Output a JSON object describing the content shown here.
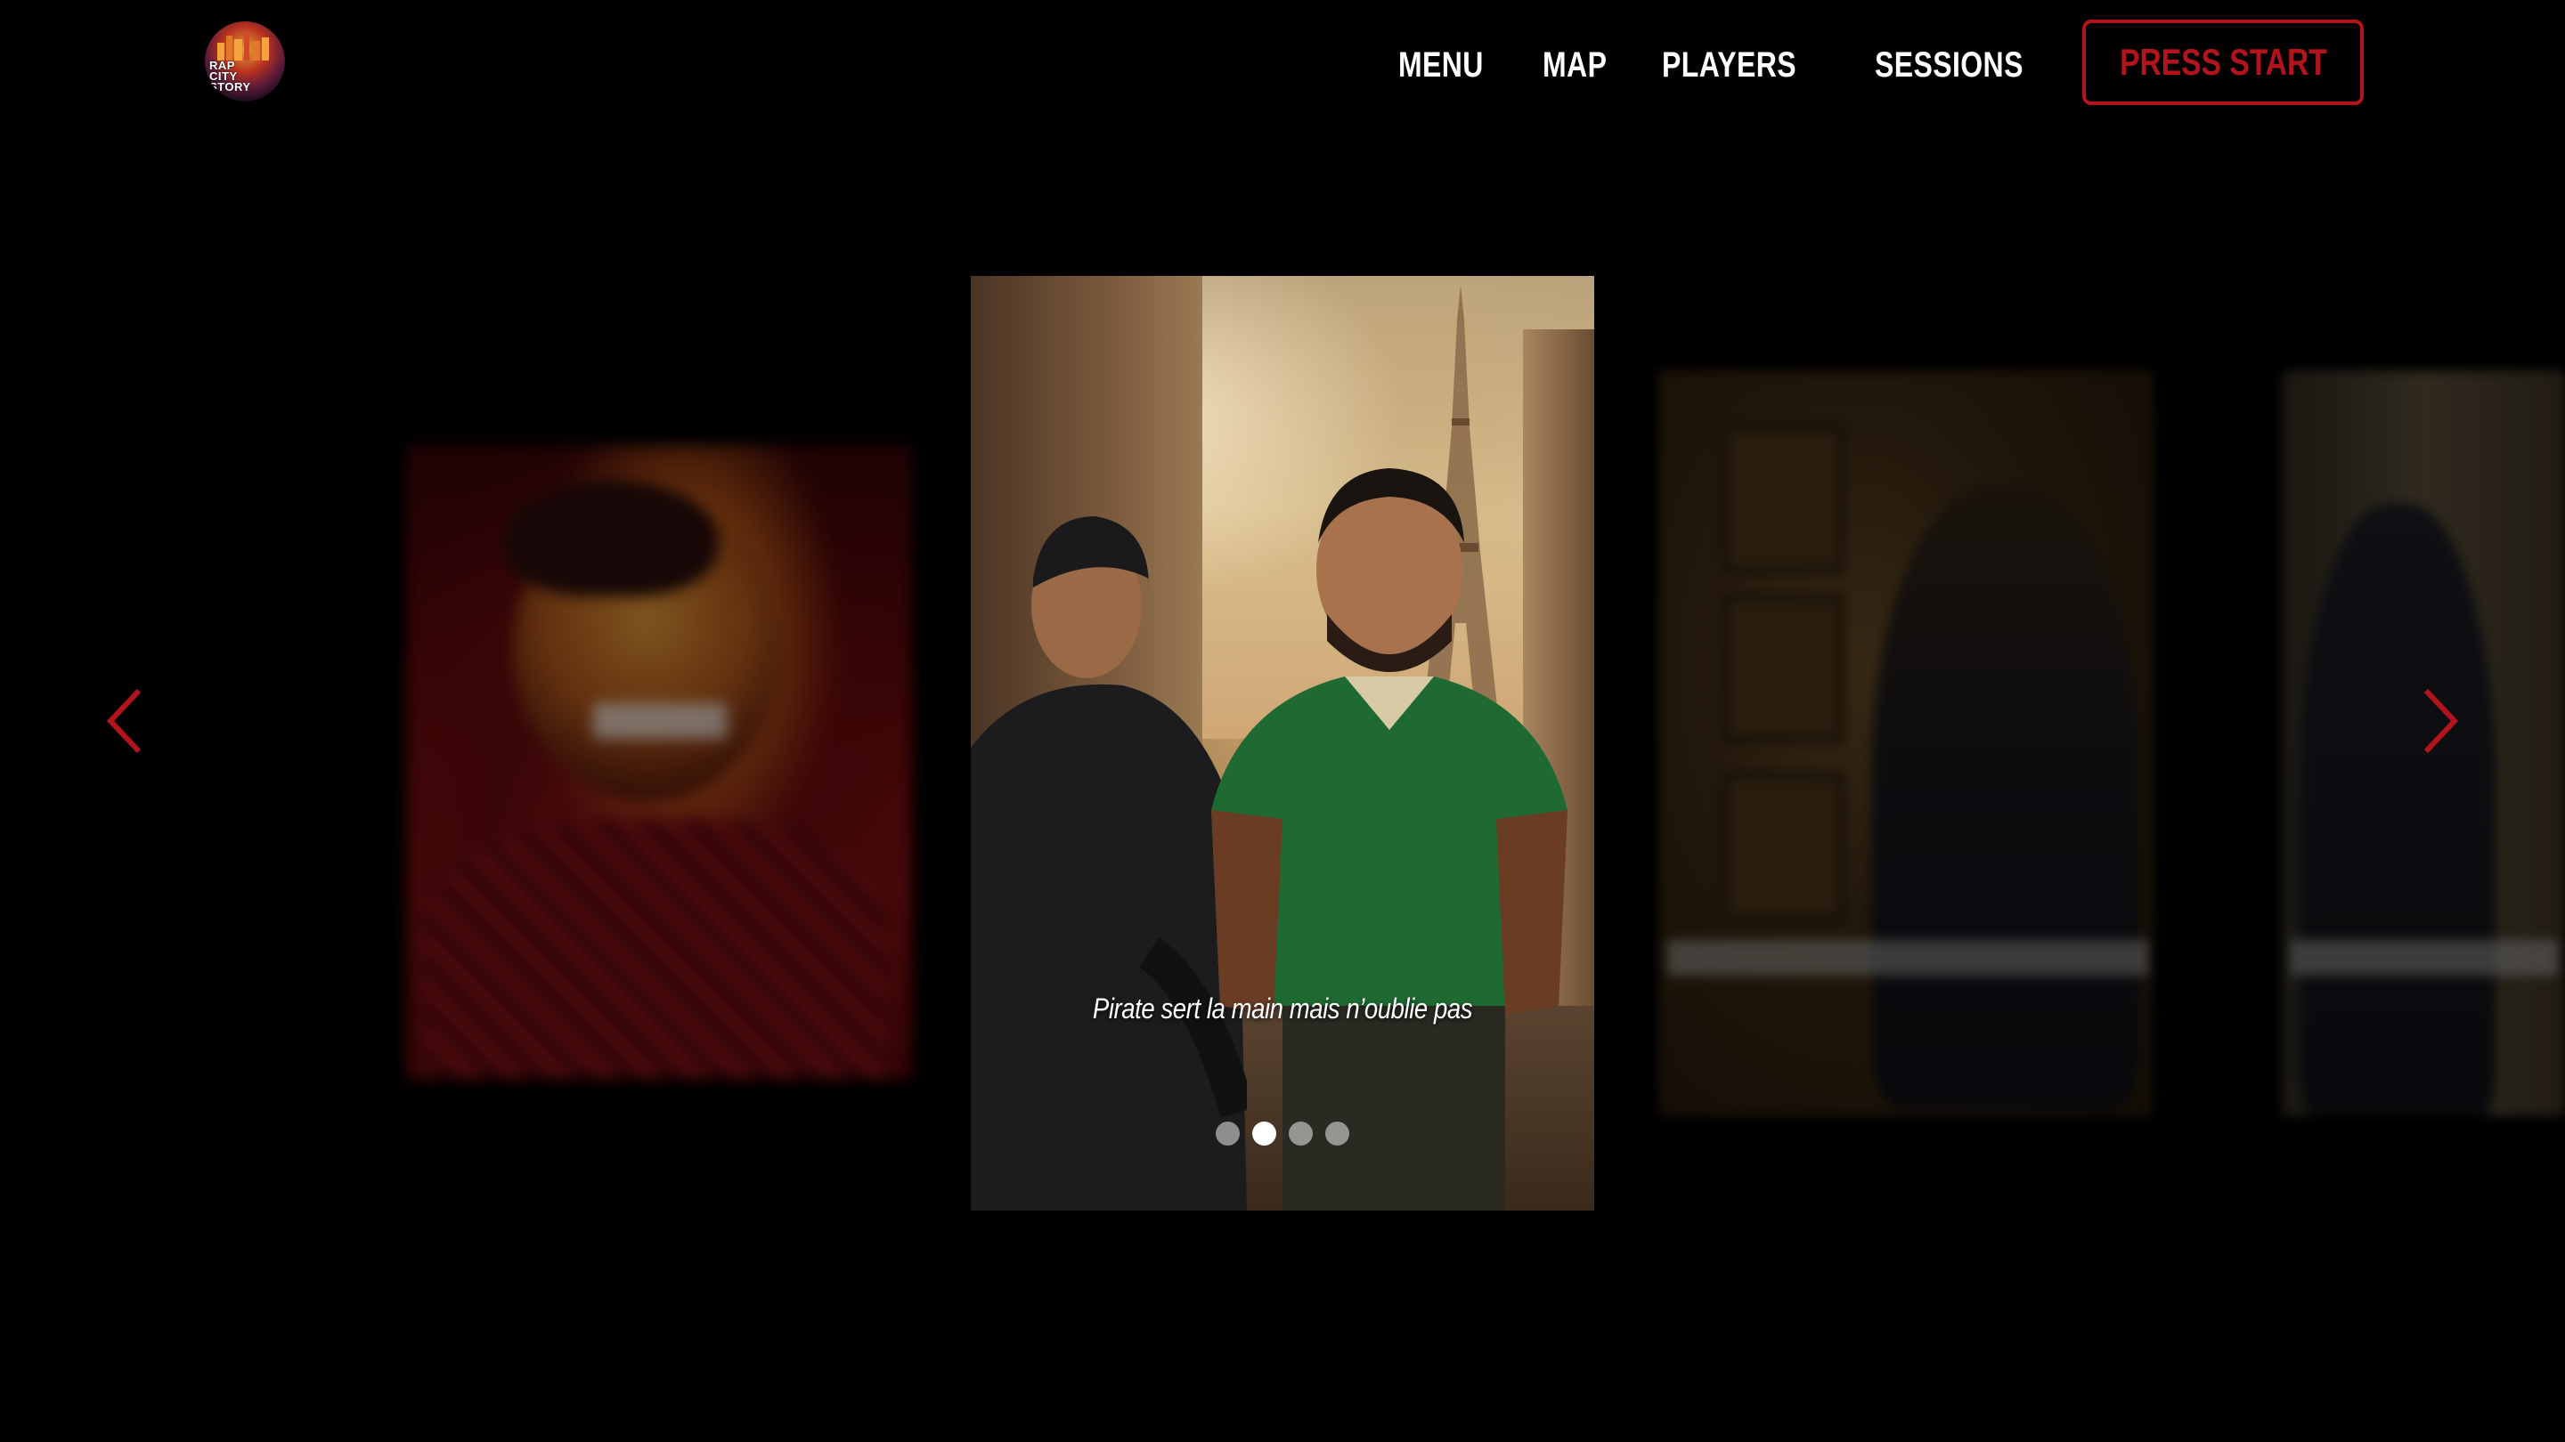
{
  "brand": {
    "logo_text": "RAP\nCITY\nSTORY"
  },
  "nav": {
    "items": [
      "MENU",
      "MAP",
      "PLAYERS",
      "SESSIONS"
    ]
  },
  "cta": {
    "label": "PRESS START"
  },
  "carousel": {
    "current_caption": "Pirate sert la main mais n’oublie pas",
    "dots_total": 4,
    "active_dot": 2,
    "arrow_left_icon": "chevron-left-icon",
    "arrow_right_icon": "chevron-right-icon"
  },
  "colors": {
    "background": "#000000",
    "accent": "#b3141c",
    "text": "#ffffff"
  }
}
